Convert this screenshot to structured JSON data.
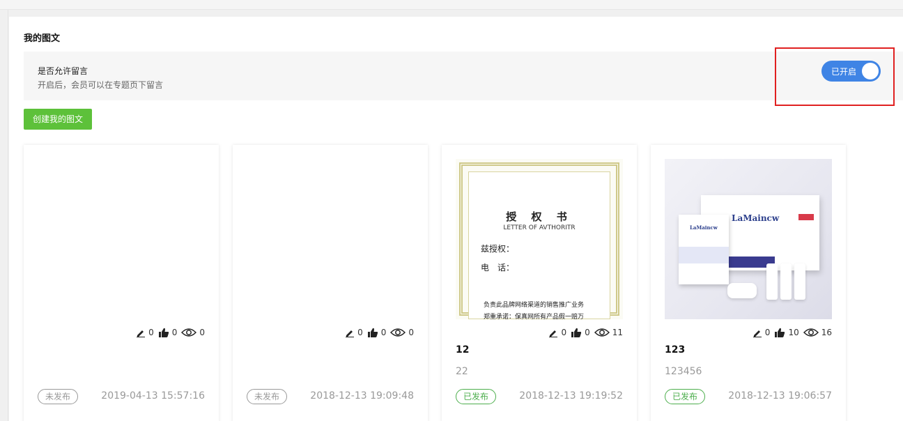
{
  "page": {
    "title": "我的图文",
    "setting": {
      "title": "是否允许留言",
      "description": "开启后，会员可以在专题页下留言",
      "toggle_label": "已开启",
      "toggle_on": true,
      "toggle_color": "#3f84e5"
    },
    "create_button": "创建我的图文",
    "create_button_color": "#5dc13a"
  },
  "cards": [
    {
      "edits": "0",
      "likes": "0",
      "views": "0",
      "title": "",
      "description": "",
      "status": "未发布",
      "time": "2019-04-13 15:57:16"
    },
    {
      "edits": "0",
      "likes": "0",
      "views": "0",
      "title": "",
      "description": "",
      "status": "未发布",
      "time": "2018-12-13 19:09:48"
    },
    {
      "edits": "0",
      "likes": "0",
      "views": "11",
      "title": "12",
      "description": "22",
      "status": "已发布",
      "time": "2018-12-13 19:19:52",
      "image": {
        "heading": "授 权 书",
        "subheading": "LETTER OF AVTHORITR",
        "line1": "兹授权：",
        "line2": "电　话：",
        "line3": "负责此品牌网络渠道的销售推广业务",
        "line4": "郑重承诺：保真网所有产品假一赔万"
      }
    },
    {
      "edits": "0",
      "likes": "10",
      "views": "16",
      "title": "123",
      "description": "123456",
      "status": "已发布",
      "time": "2018-12-13 19:06:57",
      "image": {
        "brand": "LaMaincw",
        "mask_brand": "LaMaincw"
      }
    }
  ],
  "icons": {
    "edit": "pencil-icon",
    "like": "thumbs-up-icon",
    "view": "eye-icon"
  },
  "colors": {
    "published": "#4cae4c",
    "unpublished": "#999999",
    "highlight": "#e02020"
  }
}
